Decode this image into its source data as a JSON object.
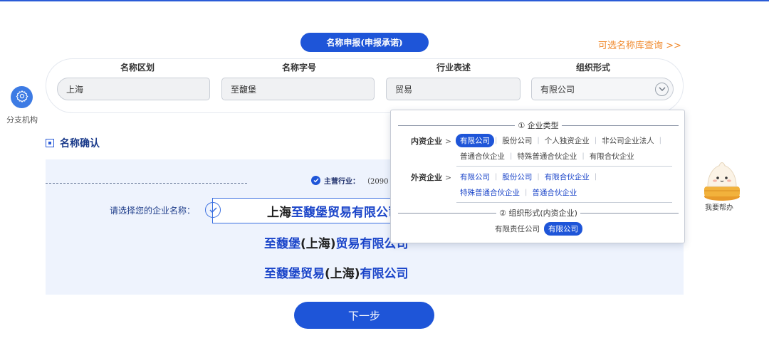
{
  "header": {
    "title": "名称申报(申报承诺)",
    "library_link": "可选名称库查询 >>"
  },
  "form": {
    "fields": [
      {
        "label": "名称区划",
        "value": "上海"
      },
      {
        "label": "名称字号",
        "value": "至馥堡"
      },
      {
        "label": "行业表述",
        "value": "贸易"
      },
      {
        "label": "组织形式",
        "value": "有限公司"
      }
    ]
  },
  "sidebar": {
    "branch_label": "分支机构",
    "branch_icon": "gear-icon"
  },
  "confirm": {
    "section_title": "名称确认",
    "main_industry_label": "主营行业：",
    "main_industry_value": "（2090",
    "choose_label": "请选择您的企业名称：",
    "selected_option": {
      "prefix": "上海",
      "middle": "至馥堡贸易有限公司"
    },
    "option2": {
      "a": "至馥堡",
      "b": "(上海)",
      "c": "贸易有限公司"
    },
    "option3": {
      "a": "至馥堡贸易",
      "b": "(上海)",
      "c": "有限公司"
    }
  },
  "dropdown": {
    "section1_title": "① 企业类型",
    "domestic_label": "内资企业",
    "domestic_options_row1": [
      "有限公司",
      "股份公司",
      "个人独资企业",
      "非公司企业法人"
    ],
    "domestic_options_row2": [
      "普通合伙企业",
      "特殊普通合伙企业",
      "有限合伙企业"
    ],
    "foreign_label": "外资企业",
    "foreign_options_row1": [
      "有限公司",
      "股份公司",
      "有限合伙企业"
    ],
    "foreign_options_row2": [
      "特殊普通合伙企业",
      "普通合伙企业"
    ],
    "section2_title": "② 组织形式(内资企业)",
    "org_options": [
      "有限责任公司",
      "有限公司"
    ],
    "arrow": ">"
  },
  "actions": {
    "next_label": "下一步"
  },
  "helper": {
    "label": "我要帮办"
  },
  "colors": {
    "primary": "#1e55d8",
    "accent_orange": "#f08a2e",
    "panel_bg": "#eef3fd"
  }
}
